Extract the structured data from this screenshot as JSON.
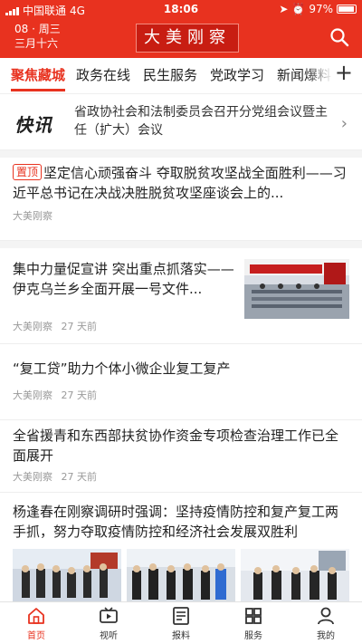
{
  "status": {
    "carrier": "中国联通",
    "network": "4G",
    "time": "18:06",
    "battery": "97%"
  },
  "header": {
    "date_line1": "08 · 周三",
    "date_line2": "三月十六",
    "logo": "大美刚察",
    "search_icon": "search-icon"
  },
  "tabs": [
    "聚焦藏城",
    "政务在线",
    "民生服务",
    "党政学习",
    "新闻爆料"
  ],
  "active_tab": 0,
  "tabs_more_icon": "plus-icon",
  "flash": {
    "badge": "快讯",
    "text": "省政协社会和法制委员会召开分党组会议暨主任（扩大）会议"
  },
  "articles": [
    {
      "pin_label": "置顶",
      "title": "坚定信心顽强奋斗 夺取脱贫攻坚战全面胜利——习近平总书记在决战决胜脱贫攻坚座谈会上的...",
      "source": "大美刚察",
      "time": ""
    },
    {
      "title": "集中力量促宣讲 突出重点抓落实——伊克乌兰乡全面开展一号文件...",
      "source": "大美刚察",
      "time": "27 天前"
    },
    {
      "title": "“复工贷”助力个体小微企业复工复产",
      "source": "大美刚察",
      "time": "27 天前"
    },
    {
      "title": "全省援青和东西部扶贫协作资金专项检查治理工作已全面展开",
      "source": "大美刚察",
      "time": "27 天前"
    },
    {
      "title": "杨逢春在刚察调研时强调：坚持疫情防控和复产复工两手抓，努力夺取疫情防控和经济社会发展双胜利",
      "source": "",
      "time": ""
    }
  ],
  "bottom_nav": [
    {
      "label": "首页",
      "icon": "home-icon"
    },
    {
      "label": "视听",
      "icon": "video-icon"
    },
    {
      "label": "报料",
      "icon": "report-icon"
    },
    {
      "label": "服务",
      "icon": "grid-icon"
    },
    {
      "label": "我的",
      "icon": "profile-icon"
    }
  ],
  "colors": {
    "accent": "#e8321f",
    "logo_bg": "#c81d12",
    "meta_text": "#9a9a9a"
  }
}
